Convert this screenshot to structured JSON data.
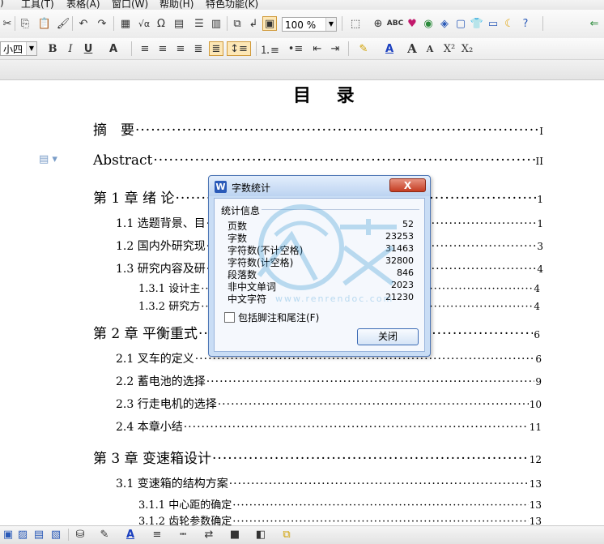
{
  "menu": {
    "items": [
      ")",
      "工具(T)",
      "表格(A)",
      "窗口(W)",
      "帮助(H)",
      "特色功能(K)"
    ]
  },
  "toolbar": {
    "zoom": "100 %",
    "font_size": "小四",
    "bold": "B",
    "italic": "I",
    "underline": "U"
  },
  "toc": {
    "title": "目 录",
    "entries": [
      {
        "text": "摘　要",
        "page": "I"
      },
      {
        "text": "Abstract",
        "page": "II"
      },
      {
        "text": "第 1 章  绪  论",
        "page": "1"
      },
      {
        "text": "1.1  选题背景、目",
        "page": "1"
      },
      {
        "text": "1.2  国内外研究现",
        "page": "3"
      },
      {
        "text": "1.3 研究内容及研",
        "page": "4"
      },
      {
        "text": "1.3.1  设计主",
        "page": "4"
      },
      {
        "text": "1.3.2  研究方",
        "page": "4"
      },
      {
        "text": "第 2 章  平衡重式",
        "page": "6"
      },
      {
        "text": "2.1  叉车的定义",
        "page": "6"
      },
      {
        "text": "2.2  蓄电池的选择",
        "page": "9"
      },
      {
        "text": "2.3  行走电机的选择",
        "page": "10"
      },
      {
        "text": "2.4  本章小结",
        "page": "11"
      },
      {
        "text": "第 3 章  变速箱设计",
        "page": "12"
      },
      {
        "text": "3.1 变速箱的结构方案",
        "page": "13"
      },
      {
        "text": "3.1.1 中心距的确定",
        "page": "13"
      },
      {
        "text": "3.1.2 齿轮参数确定",
        "page": "13"
      }
    ]
  },
  "dialog": {
    "title": "字数统计",
    "close_x": "X",
    "group_label": "统计信息",
    "stats": [
      {
        "label": "页数",
        "value": "52"
      },
      {
        "label": "字数",
        "value": "23253"
      },
      {
        "label": "字符数(不计空格)",
        "value": "31463"
      },
      {
        "label": "字符数(计空格)",
        "value": "32800"
      },
      {
        "label": "段落数",
        "value": "846"
      },
      {
        "label": "非中文单词",
        "value": "2023"
      },
      {
        "label": "中文字符",
        "value": "21230"
      }
    ],
    "checkbox_label": "包括脚注和尾注(F)",
    "close_button": "关闭"
  },
  "watermark": {
    "text": "人人文库",
    "url": "www.renrendoc.com"
  },
  "colors": {
    "dialog_bg": "#c9ddf5",
    "dialog_border": "#4f77b6",
    "close_red": "#c43c22",
    "accent_blue": "#2a5ab8"
  }
}
